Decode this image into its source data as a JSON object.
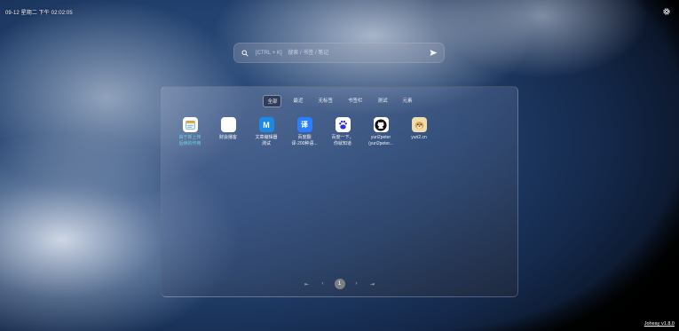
{
  "datetime": "09-12 星期二 下午 02:02:05",
  "search": {
    "placeholder": "[CTRL + K]    搜索 / 书签 / 笔记"
  },
  "tabs": [
    {
      "label": "全部",
      "active": true
    },
    {
      "label": "最近"
    },
    {
      "label": "无标签"
    },
    {
      "label": "书签栏"
    },
    {
      "label": "测试"
    },
    {
      "label": "元素"
    }
  ],
  "items": [
    {
      "label": "由于新上传\n后续的作用",
      "icon": "notepad-icon",
      "icon_color": "#f0a020",
      "highlight": true
    },
    {
      "label": "财会播客",
      "icon": "blank-icon",
      "icon_color": "#ffffff"
    },
    {
      "label": "文章编辑器\n测试",
      "icon": "m-icon",
      "icon_color": "#1e88e5",
      "icon_text": "M"
    },
    {
      "label": "百度翻\n译-200种语...",
      "icon": "translate-icon",
      "icon_color": "#2a7fff",
      "icon_text": "译"
    },
    {
      "label": "百度一下，\n你就知道",
      "icon": "baidu-paw-icon",
      "icon_color": "#2932e1"
    },
    {
      "label": "yuri2peter\n(yuri2peter...",
      "icon": "github-icon",
      "icon_color": "#111111"
    },
    {
      "label": "yuri2.cn",
      "icon": "doge-icon",
      "icon_color": "#d9a441"
    }
  ],
  "pager": {
    "first": "⇤",
    "prev": "‹",
    "current": "1",
    "next": "›",
    "last": "⇥"
  },
  "version": "Joheay v1.8.0"
}
